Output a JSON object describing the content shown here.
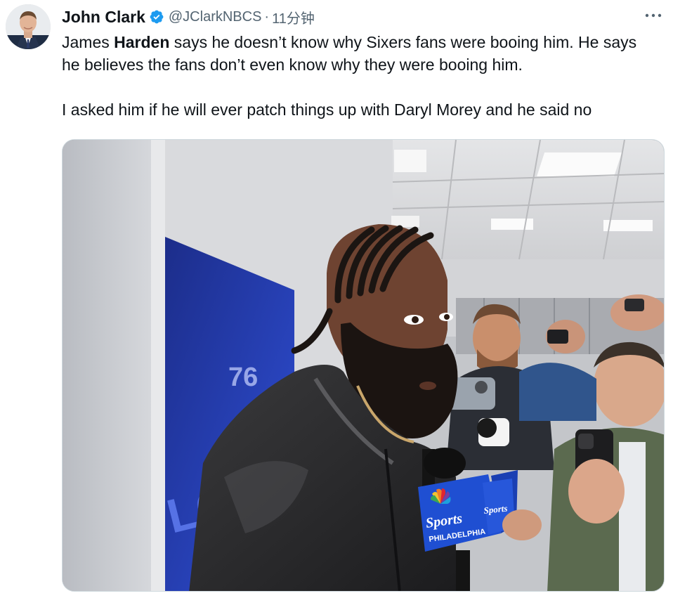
{
  "tweet": {
    "author": {
      "display_name": "John Clark",
      "handle": "@JClarkNBCS",
      "verified": true,
      "avatar_icon": "profile-photo"
    },
    "separator": "·",
    "timestamp": "11分钟",
    "more_icon": "more-horizontal-icon",
    "text": {
      "line1_prefix": "James ",
      "line1_bold": "Harden",
      "line1_suffix": " says he doesn’t know why Sixers fans were booing him. He says he believes the fans don’t even know why they were booing him.",
      "paragraph2": "I asked him if he will ever patch things up with Daryl Morey and he said no"
    },
    "media": {
      "type": "photo",
      "mic_flag_text": "Sports",
      "mic_flag_subtext": "PHILADELPHIA",
      "screen_text": "LCOME",
      "screen_number": "76"
    }
  },
  "colors": {
    "text_primary": "#0f1419",
    "text_secondary": "#536471",
    "verified_blue": "#1d9bf0",
    "border": "#cfd9de"
  }
}
